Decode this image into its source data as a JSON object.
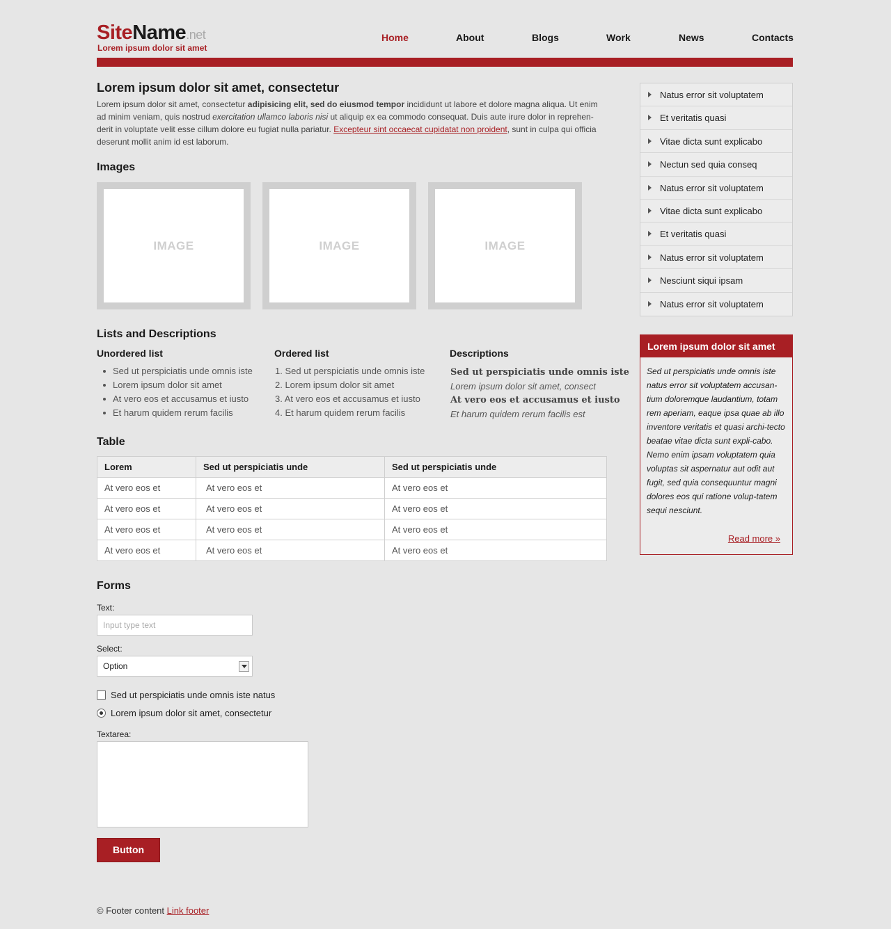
{
  "header": {
    "logo_site": "Site",
    "logo_name": "Name",
    "logo_net": ".net",
    "tagline": "Lorem ipsum dolor sit amet"
  },
  "nav": {
    "items": [
      "Home",
      "About",
      "Blogs",
      "Work",
      "News",
      "Contacts"
    ],
    "active": "Home"
  },
  "main": {
    "title": "Lorem ipsum dolor sit amet, consectetur",
    "intro": {
      "p1": "Lorem ipsum dolor sit amet, consectetur ",
      "b1": "adipisicing elit, sed do eiusmod tempor",
      "p2": " incididunt ut labore et dolore magna aliqua. Ut enim ad minim veniam, quis nostrud ",
      "i1": "exercitation ullamco laboris nisi",
      "p3": " ut aliquip ex ea commodo consequat. Duis aute irure dolor in reprehen-derit in voluptate velit esse cillum dolore eu fugiat nulla pariatur. ",
      "link": "Excepteur sint occaecat cupidatat non proident",
      "p4": ", sunt in culpa qui officia deserunt mollit anim id est laborum."
    },
    "images_heading": "Images",
    "image_placeholder": "IMAGE",
    "lists_heading": "Lists and Descriptions",
    "unordered": {
      "heading": "Unordered list",
      "items": [
        "Sed ut perspiciatis unde omnis iste",
        "Lorem ipsum dolor sit amet",
        "At vero eos et accusamus et iusto",
        "Et harum quidem rerum facilis"
      ]
    },
    "ordered": {
      "heading": "Ordered list",
      "items": [
        "1. Sed ut perspiciatis unde omnis iste",
        "2. Lorem ipsum dolor sit amet",
        "3. At vero eos et accusamus et iusto",
        "4. Et harum quidem rerum facilis"
      ]
    },
    "descriptions": {
      "heading": "Descriptions",
      "term1": "Sed ut perspiciatis unde omnis iste",
      "def1": "Lorem ipsum dolor sit amet, consect",
      "term2": "At vero eos et accusamus et iusto",
      "def2": "Et harum quidem rerum facilis est"
    },
    "table_heading": "Table",
    "table": {
      "headers": [
        "Lorem",
        "Sed ut perspiciatis unde",
        "Sed ut perspiciatis unde"
      ],
      "rows": [
        [
          "At vero eos et",
          "At vero eos et",
          "At vero eos et"
        ],
        [
          "At vero eos et",
          "At vero eos et",
          "At vero eos et"
        ],
        [
          "At vero eos et",
          "At vero eos et",
          "At vero eos et"
        ],
        [
          "At vero eos et",
          "At vero eos et",
          "At vero eos et"
        ]
      ]
    },
    "forms": {
      "heading": "Forms",
      "text_label": "Text:",
      "text_placeholder": "Input type text",
      "select_label": "Select:",
      "select_value": "Option",
      "checkbox_label": "Sed ut perspiciatis unde omnis iste natus",
      "radio_label": "Lorem ipsum dolor sit amet, consectetur",
      "textarea_label": "Textarea:",
      "button_label": "Button"
    }
  },
  "sidebar": {
    "menu": [
      "Natus error sit voluptatem",
      "Et veritatis quasi",
      "Vitae dicta sunt explicabo",
      "Nectun sed quia conseq",
      "Natus error sit voluptatem",
      "Vitae dicta sunt explicabo",
      "Et veritatis quasi",
      "Natus error sit voluptatem",
      "Nesciunt siqui ipsam",
      "Natus error sit voluptatem"
    ],
    "box": {
      "title": "Lorem ipsum dolor sit amet",
      "body": "Sed ut perspiciatis unde omnis iste natus error sit voluptatem accusan-tium doloremque laudantium, totam rem aperiam, eaque ipsa quae ab illo inventore veritatis et quasi archi-tecto beatae vitae dicta sunt expli-cabo. Nemo enim ipsam voluptatem quia voluptas sit aspernatur aut odit aut fugit, sed quia consequuntur magni dolores eos qui ratione volup-tatem sequi nesciunt.",
      "read_more": "Read more »"
    }
  },
  "footer": {
    "text": "© Footer content ",
    "link": "Link footer"
  },
  "colors": {
    "accent": "#a81f24",
    "background": "#e6e6e6"
  }
}
